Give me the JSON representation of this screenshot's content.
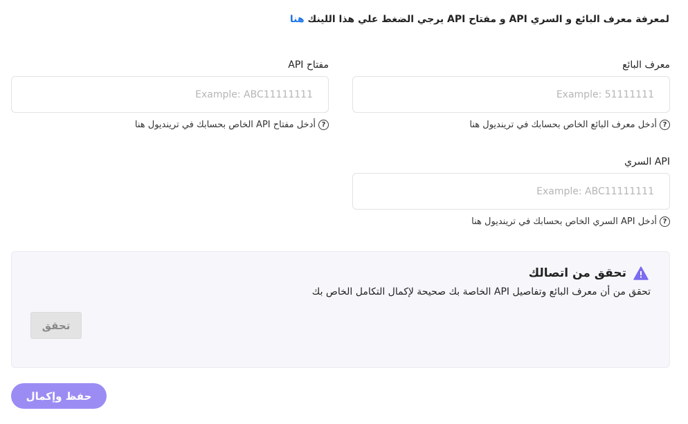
{
  "intro": {
    "text": "لمعرفة معرف البائع و السري API و مفتاح API يرجي الضغط علي هذا اللينك ",
    "link": "هنا"
  },
  "fields": {
    "vendor_id": {
      "label": "معرف البائع",
      "placeholder": "Example: 51111111",
      "help": "أدخل معرف البائع الخاص بحسابك في ترينديول هنا"
    },
    "api_key": {
      "label": "مفتاح API",
      "placeholder": "Example: ABC11111111",
      "help": "أدخل مفتاح API الخاص بحسابك في ترينديول هنا"
    },
    "api_secret": {
      "label": "API السري",
      "placeholder": "Example: ABC11111111",
      "help": "أدخل API السري الخاص بحسابك في ترينديول هنا"
    }
  },
  "help_icon_glyph": "?",
  "verify": {
    "title": "تحقق من اتصالك",
    "description": "تحقق من أن معرف البائع وتفاصيل API الخاصة بك صحيحة لإكمال التكامل الخاص بك",
    "button": "تحقق",
    "warning_color": "#7b6cf0"
  },
  "save": {
    "button": "حفظ وإكمال",
    "color": "#9b8cf4"
  }
}
